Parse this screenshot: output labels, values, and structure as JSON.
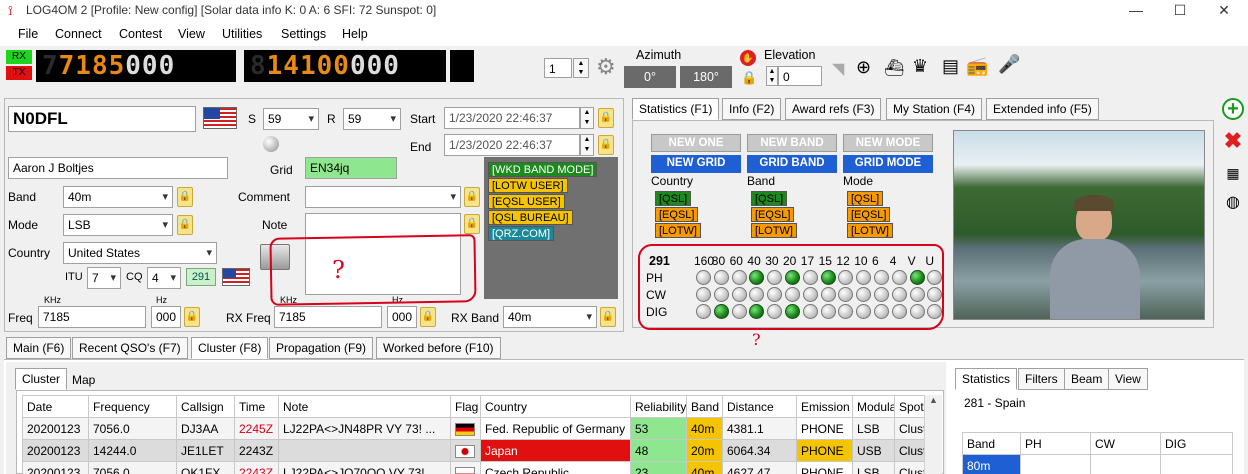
{
  "window": {
    "title": "LOG4OM 2 [Profile: New config] [Solar data info K: 0 A: 6 SFI: 72 Sunspot: 0]",
    "min": "—",
    "max": "☐",
    "close": "✕"
  },
  "menu": [
    "File",
    "Connect",
    "Contest",
    "View",
    "Utilities",
    "Settings",
    "Help"
  ],
  "radio": {
    "rx": "RX",
    "tx": "TX",
    "freq1_lit": "7185",
    "freq1_dim": "7",
    "freq1_rest": "000",
    "freq2_lit": "14100",
    "freq2_rest": "000",
    "freq2_dim": "8",
    "radio_num": "1",
    "azimuth_label": "Azimuth",
    "az0": "0°",
    "az180": "180°",
    "elevation_label": "Elevation",
    "elevation_value": "0"
  },
  "qso": {
    "callsign": "N0DFL",
    "s_label": "S",
    "s_value": "59",
    "r_label": "R",
    "r_value": "59",
    "start_label": "Start",
    "start_value": "1/23/2020 22:46:37",
    "end_label": "End",
    "end_value": "1/23/2020 22:46:37",
    "name": "Aaron J Boltjes",
    "grid_label": "Grid",
    "grid_value": "EN34jq",
    "band_label": "Band",
    "band_value": "40m",
    "mode_label": "Mode",
    "mode_value": "LSB",
    "comment_label": "Comment",
    "comment_value": "",
    "note_label": "Note",
    "note_value": "",
    "country_label": "Country",
    "country_value": "United States",
    "itu_label": "ITU",
    "itu_value": "7",
    "cq_label": "CQ",
    "cq_value": "4",
    "dxcc_num": "291",
    "khz_label": "KHz",
    "hz_label": "Hz",
    "freq_label": "Freq",
    "freq_value": "7185",
    "freq_hz": "000",
    "rxfreq_label": "RX Freq",
    "rxfreq_value": "7185",
    "rxfreq_hz": "000",
    "rxband_label": "RX Band",
    "rxband_value": "40m",
    "info_tags": [
      "[WKD BAND MODE]",
      "[LOTW USER]",
      "[EQSL USER]",
      "[QSL BUREAU]",
      "[QRZ.COM]"
    ],
    "annotation": "?"
  },
  "stats": {
    "tabs": [
      "Statistics (F1)",
      "Info (F2)",
      "Award refs (F3)",
      "My Station (F4)",
      "Extended info (F5)"
    ],
    "headers_top": [
      "NEW ONE",
      "NEW BAND",
      "NEW MODE"
    ],
    "headers_bottom": [
      "NEW GRID",
      "GRID BAND",
      "GRID MODE"
    ],
    "col_labels": [
      "Country",
      "Band",
      "Mode"
    ],
    "qsl": [
      "[QSL]",
      "[EQSL]",
      "[LOTW]"
    ],
    "dxcc": "291",
    "bands": [
      "160",
      "80",
      "60",
      "40",
      "30",
      "20",
      "17",
      "15",
      "12",
      "10",
      "6",
      "4",
      "V",
      "U"
    ],
    "rows": [
      {
        "name": "PH",
        "on": [
          0,
          0,
          0,
          1,
          0,
          1,
          0,
          1,
          0,
          0,
          0,
          0,
          1,
          0
        ]
      },
      {
        "name": "CW",
        "on": [
          0,
          0,
          0,
          0,
          0,
          0,
          0,
          0,
          0,
          0,
          0,
          0,
          0,
          0
        ]
      },
      {
        "name": "DIG",
        "on": [
          0,
          1,
          0,
          1,
          0,
          1,
          0,
          0,
          0,
          0,
          0,
          0,
          0,
          0
        ]
      }
    ],
    "annotation": "?"
  },
  "lower_tabs": [
    "Main (F6)",
    "Recent QSO's (F7)",
    "Cluster (F8)",
    "Propagation (F9)",
    "Worked before (F10)"
  ],
  "cluster": {
    "subtabs": [
      "Cluster",
      "Map"
    ],
    "columns": [
      "Date",
      "Frequency",
      "Callsign",
      "Time",
      "Note",
      "Flag",
      "Country",
      "Reliability",
      "Band",
      "Distance",
      "Emission",
      "Modula",
      "Spot"
    ],
    "rows": [
      [
        "20200123",
        "7056.0",
        "DJ3AA",
        "2245Z",
        "LJ22PA<>JN48PR VY 73! ...",
        "",
        "Fed. Republic of Germany",
        "53",
        "40m",
        "4381.1",
        "PHONE",
        "LSB",
        "Cluste"
      ],
      [
        "20200123",
        "14244.0",
        "JE1LET",
        "2243Z",
        "",
        "",
        "Japan",
        "48",
        "20m",
        "6064.34",
        "PHONE",
        "USB",
        "Cluste"
      ],
      [
        "20200123",
        "7056.0",
        "OK1FX",
        "2243Z",
        "LJ22PA<>JO70OO VY 73!",
        "",
        "Czech Republic",
        "23",
        "40m",
        "4627.47",
        "PHONE",
        "LSB",
        "Cluste"
      ]
    ]
  },
  "right_panel": {
    "tabs": [
      "Statistics",
      "Filters",
      "Beam",
      "View"
    ],
    "country_line": "281 - Spain",
    "columns": [
      "Band",
      "PH",
      "CW",
      "DIG"
    ],
    "first_row": "80m"
  },
  "colors": {
    "accent_blue": "#1e5fd4",
    "green_led": "#1e8b1e",
    "freq_orange": "#e88a14",
    "annotation_red": "#d8001a"
  }
}
